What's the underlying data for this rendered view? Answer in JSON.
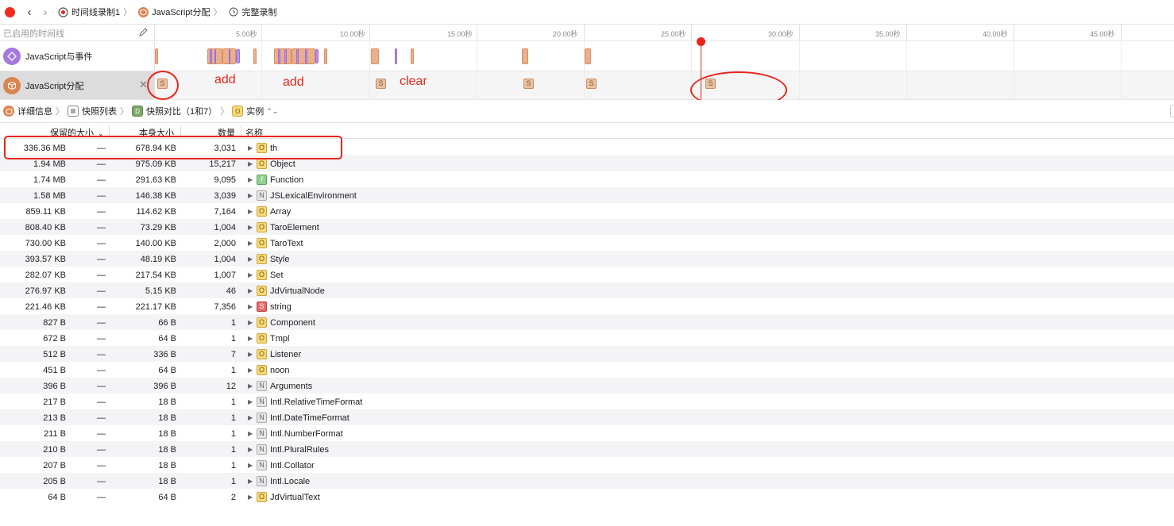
{
  "nav": {
    "crumbs": [
      {
        "label": "时间线录制1",
        "icon": "timeline-recording-icon"
      },
      {
        "label": "JavaScript分配",
        "icon": "javascript-allocations-icon"
      },
      {
        "label": "完整录制",
        "icon": "clock-icon"
      }
    ],
    "back_icon": "‹",
    "forward_icon": "›"
  },
  "timeline": {
    "filter_placeholder": "已启用的时间线",
    "ticks": [
      "5.00秒",
      "10.00秒",
      "15.00秒",
      "20.00秒",
      "25.00秒",
      "30.00秒",
      "35.00秒",
      "40.00秒",
      "45.00秒"
    ],
    "tracks": [
      {
        "name": "JavaScript与事件",
        "color": "#a27ae0"
      },
      {
        "name": "JavaScript分配",
        "color": "#d9854f"
      }
    ],
    "snapshot_glyph": "S",
    "close_glyph": "✕"
  },
  "annotations": [
    "add",
    "add",
    "clear"
  ],
  "pathbar": {
    "items": [
      {
        "label": "详细信息",
        "icon": "details-icon"
      },
      {
        "label": "快照列表",
        "icon": "list-icon"
      },
      {
        "label": "快照对比（1和7）",
        "icon": "diff-icon",
        "badge": "D"
      },
      {
        "label": "实例",
        "icon": "instance-icon",
        "badge": "O"
      }
    ],
    "instance_chevron": "⌃⌄"
  },
  "table": {
    "headers": {
      "retained": "保留的大小",
      "self": "本身大小",
      "count": "数量",
      "name": "名称"
    },
    "sort_indicator": "⌄",
    "rows": [
      {
        "retained": "336.36 MB",
        "dash": "—",
        "self": "678.94 KB",
        "count": "3,031",
        "type": "O",
        "name": "th"
      },
      {
        "retained": "1.94 MB",
        "dash": "—",
        "self": "975.09 KB",
        "count": "15,217",
        "type": "O",
        "name": "Object"
      },
      {
        "retained": "1.74 MB",
        "dash": "—",
        "self": "291.63 KB",
        "count": "9,095",
        "type": "f",
        "name": "Function"
      },
      {
        "retained": "1.58 MB",
        "dash": "—",
        "self": "146.38 KB",
        "count": "3,039",
        "type": "N",
        "name": "JSLexicalEnvironment"
      },
      {
        "retained": "859.11 KB",
        "dash": "—",
        "self": "114.62 KB",
        "count": "7,164",
        "type": "O",
        "name": "Array"
      },
      {
        "retained": "808.40 KB",
        "dash": "—",
        "self": "73.29 KB",
        "count": "1,004",
        "type": "O",
        "name": "TaroElement"
      },
      {
        "retained": "730.00 KB",
        "dash": "—",
        "self": "140.00 KB",
        "count": "2,000",
        "type": "O",
        "name": "TaroText"
      },
      {
        "retained": "393.57 KB",
        "dash": "—",
        "self": "48.19 KB",
        "count": "1,004",
        "type": "O",
        "name": "Style"
      },
      {
        "retained": "282.07 KB",
        "dash": "—",
        "self": "217.54 KB",
        "count": "1,007",
        "type": "O",
        "name": "Set"
      },
      {
        "retained": "276.97 KB",
        "dash": "—",
        "self": "5.15 KB",
        "count": "46",
        "type": "O",
        "name": "JdVirtualNode"
      },
      {
        "retained": "221.46 KB",
        "dash": "—",
        "self": "221.17 KB",
        "count": "7,356",
        "type": "S",
        "name": "string"
      },
      {
        "retained": "827 B",
        "dash": "—",
        "self": "66 B",
        "count": "1",
        "type": "O",
        "name": "Component"
      },
      {
        "retained": "672 B",
        "dash": "—",
        "self": "64 B",
        "count": "1",
        "type": "O",
        "name": "Tmpl"
      },
      {
        "retained": "512 B",
        "dash": "—",
        "self": "336 B",
        "count": "7",
        "type": "O",
        "name": "Listener"
      },
      {
        "retained": "451 B",
        "dash": "—",
        "self": "64 B",
        "count": "1",
        "type": "O",
        "name": "noon"
      },
      {
        "retained": "396 B",
        "dash": "—",
        "self": "396 B",
        "count": "12",
        "type": "N",
        "name": "Arguments"
      },
      {
        "retained": "217 B",
        "dash": "—",
        "self": "18 B",
        "count": "1",
        "type": "N",
        "name": "Intl.RelativeTimeFormat"
      },
      {
        "retained": "213 B",
        "dash": "—",
        "self": "18 B",
        "count": "1",
        "type": "N",
        "name": "Intl.DateTimeFormat"
      },
      {
        "retained": "211 B",
        "dash": "—",
        "self": "18 B",
        "count": "1",
        "type": "N",
        "name": "Intl.NumberFormat"
      },
      {
        "retained": "210 B",
        "dash": "—",
        "self": "18 B",
        "count": "1",
        "type": "N",
        "name": "Intl.PluralRules"
      },
      {
        "retained": "207 B",
        "dash": "—",
        "self": "18 B",
        "count": "1",
        "type": "N",
        "name": "Intl.Collator"
      },
      {
        "retained": "205 B",
        "dash": "—",
        "self": "18 B",
        "count": "1",
        "type": "N",
        "name": "Intl.Locale"
      },
      {
        "retained": "64 B",
        "dash": "—",
        "self": "64 B",
        "count": "2",
        "type": "O",
        "name": "JdVirtualText"
      }
    ]
  },
  "colors": {
    "record": "#f02b1d",
    "annotation": "#e8251c",
    "snapshot": "#e8c2a3",
    "bar": "#eab08b",
    "bar_purple": "#b792e6"
  }
}
